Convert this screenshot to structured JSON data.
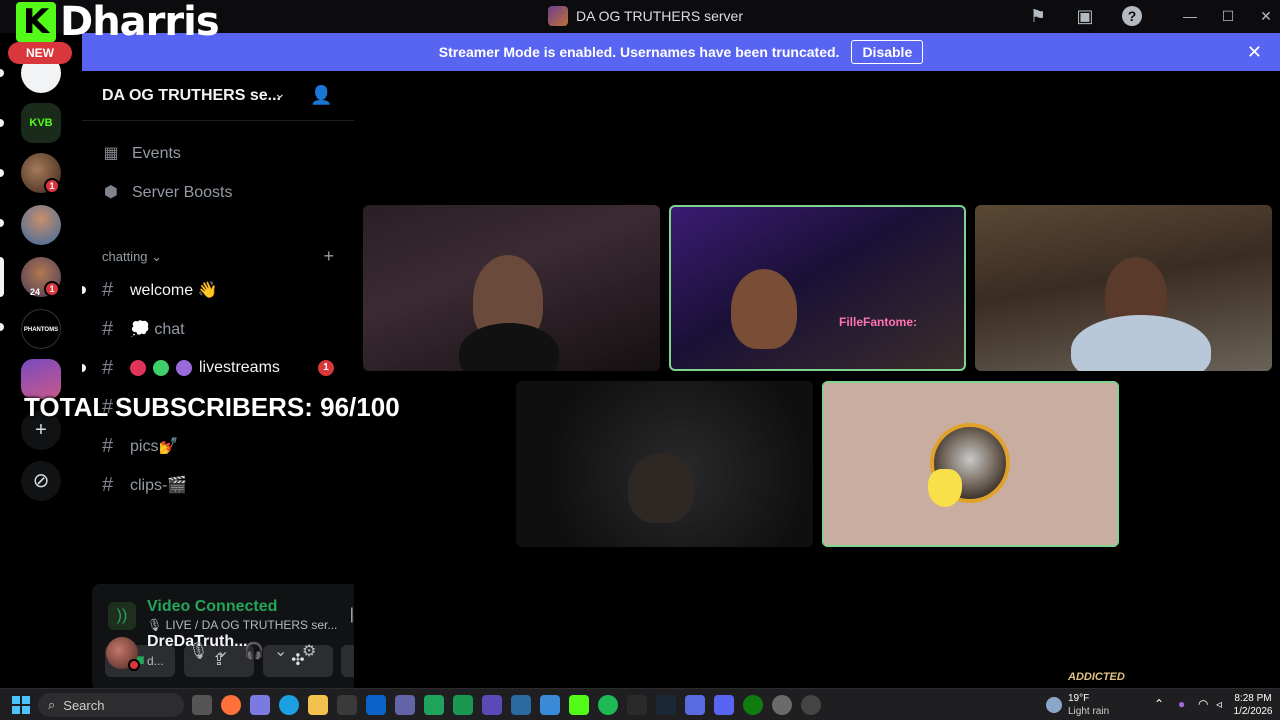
{
  "brand": {
    "logo_letter": "K",
    "name": "Dharris"
  },
  "window": {
    "title": "DA OG TRUTHERS server"
  },
  "banner": {
    "message": "Streamer Mode is enabled. Usernames have been truncated.",
    "disable_label": "Disable",
    "close": "✕"
  },
  "rail": {
    "new_label": "NEW",
    "server2_label": "KVB",
    "server3_badge": "1",
    "server5_badge": "1",
    "server5_sub": "24",
    "server6_label": "PHANTOMS"
  },
  "sidebar": {
    "server_name": "DA OG TRUTHERS se...",
    "events_label": "Events",
    "boosts_label": "Server Boosts",
    "category": "chatting",
    "channels": [
      {
        "name": "welcome 👋"
      },
      {
        "name": "💭 chat"
      },
      {
        "name": "livestreams",
        "badge": "1"
      },
      {
        "name": ""
      },
      {
        "name": "pics💅"
      },
      {
        "name": "clips-🎬"
      }
    ]
  },
  "voice": {
    "status": "Video Connected",
    "detail": "🎙 LIVE / DA OG TRUTHERS ser..."
  },
  "user": {
    "name": "DreDaTruth...",
    "status": "d..."
  },
  "overlay": {
    "subscribers": "TOTAL SUBSCRIBERS: 96/100",
    "tile_name": "FilleFantome:",
    "watermark": "ADDICTED"
  },
  "taskbar": {
    "search_label": "Search",
    "weather_temp": "19°F",
    "weather_desc": "Light rain",
    "time": "8:28 PM",
    "date": "1/2/2026"
  },
  "colors": {
    "accent": "#5865f2",
    "connected": "#23a55a",
    "speaking": "#7fd38f",
    "kick": "#53fc18",
    "danger": "#da373c"
  }
}
